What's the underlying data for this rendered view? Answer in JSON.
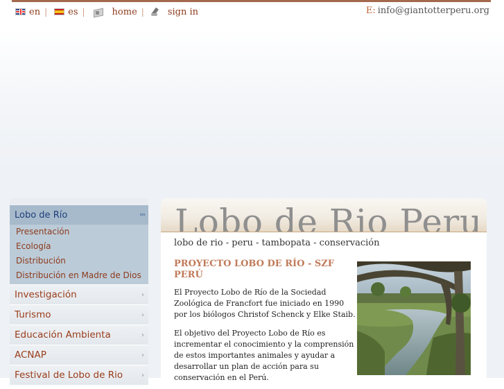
{
  "topbar": {
    "lang_en": "en",
    "lang_es": "es",
    "home": "home",
    "sign_in": "sign in",
    "email_label": "E:",
    "email": "info@giantotterperu.org",
    "separator": "|"
  },
  "sidebar": {
    "active": {
      "label": "Lobo de Río",
      "arrows": "›››",
      "subitems": [
        "Presentación",
        "Ecología",
        "Distribución",
        "Distribución en Madre de Dios"
      ]
    },
    "items": [
      {
        "label": "Investigación"
      },
      {
        "label": "Turismo"
      },
      {
        "label": "Educación Ambienta"
      },
      {
        "label": "ACNAP"
      },
      {
        "label": "Festival de Lobo de Rio"
      }
    ],
    "chevron": "›"
  },
  "content": {
    "banner_title": "Lobo de Rio Peru",
    "tagline": "lobo de rio - peru - tambopata - conservación",
    "heading": "PROYECTO LOBO DE RÍO - SZF PERÚ",
    "paragraph1": "El Proyecto Lobo de Río de la Sociedad Zoológica de Francfort fue iniciado en 1990 por los biólogos Christof Schenck y Elke Staib.",
    "paragraph2": "El objetivo del Proyecto Lobo de Río es incrementar el conocimiento y la comprensión de estos importantes animales y ayudar a desarrollar un plan de acción para su conservación en el Perú."
  },
  "colors": {
    "accent_rust": "#8c3b1d",
    "active_nav": "#a7bacb",
    "heading": "#c07a5a"
  }
}
